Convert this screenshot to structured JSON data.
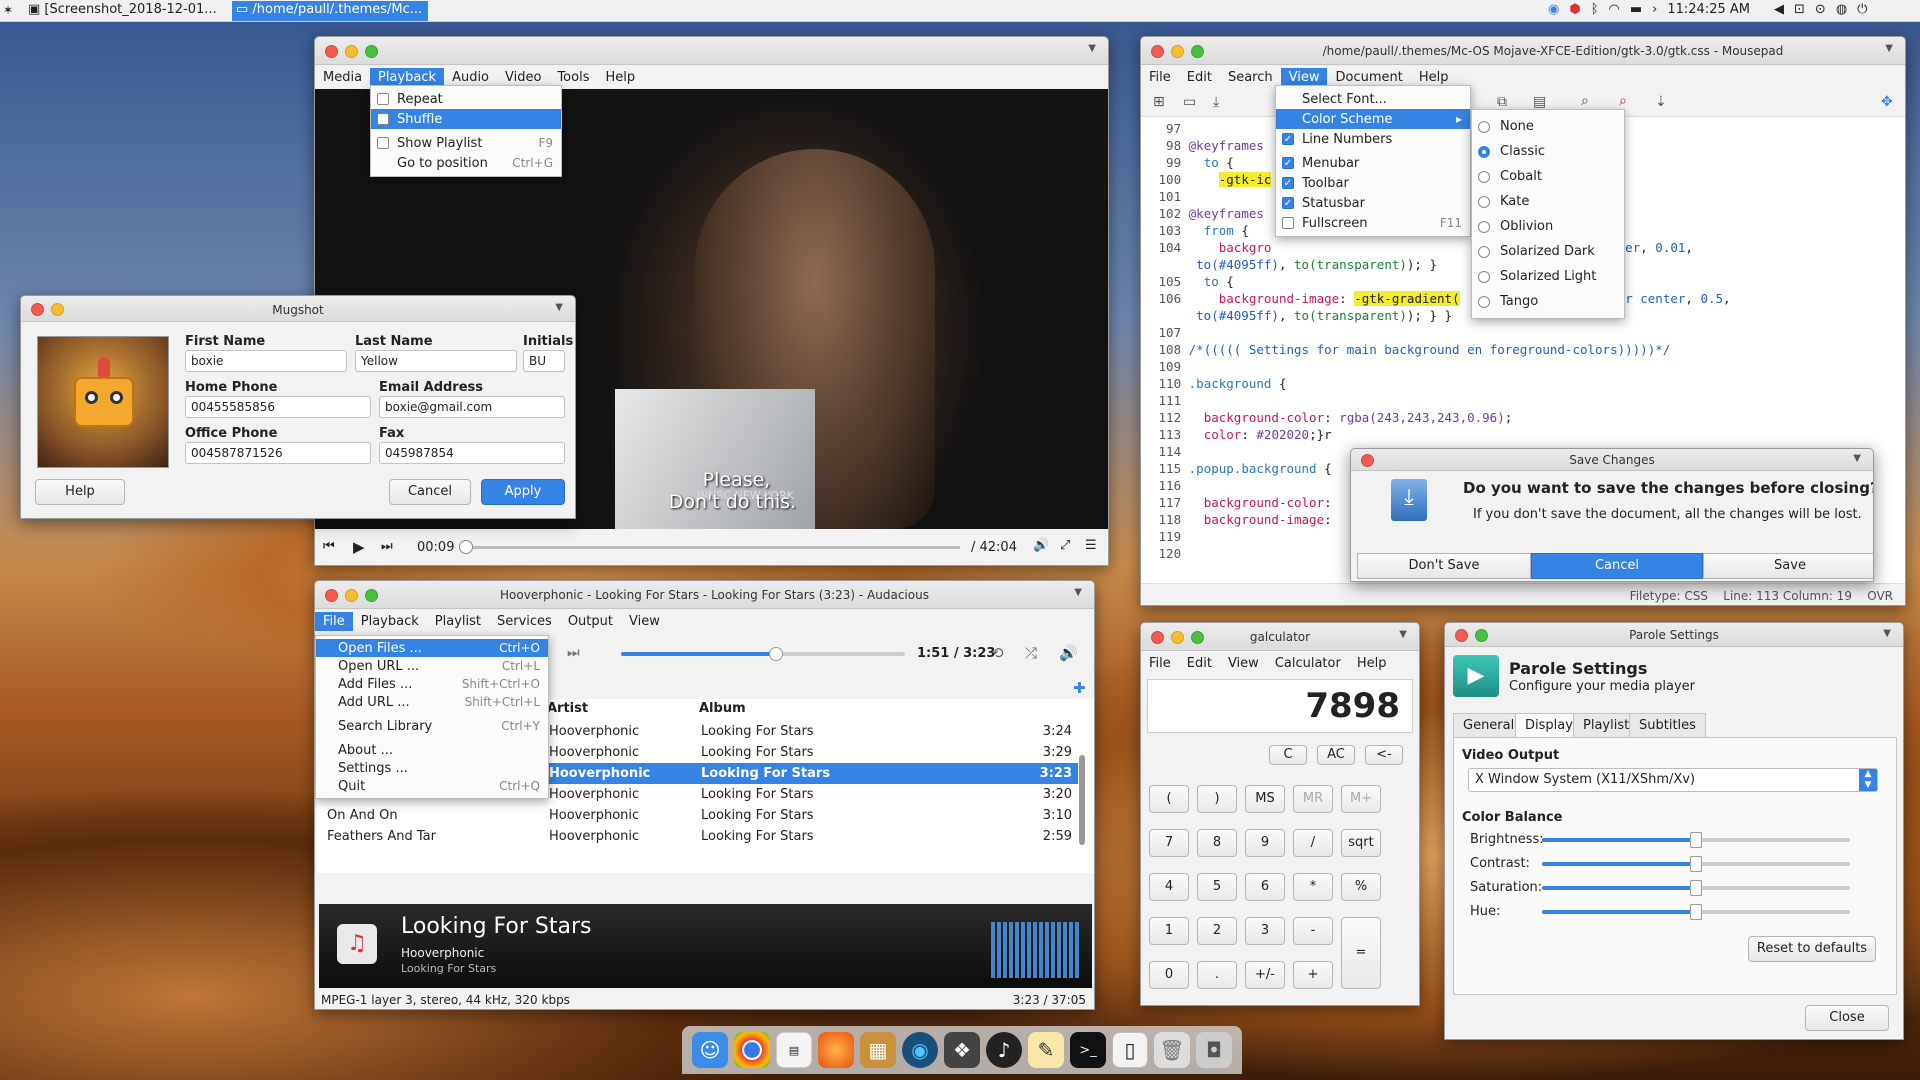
{
  "panel": {
    "task1": "[Screenshot_2018-12-01...",
    "task2": "/home/paull/.themes/Mc...",
    "time": "11:24:25 AM",
    "arrow": "›"
  },
  "vlc": {
    "menus": [
      "Media",
      "Playback",
      "Audio",
      "Video",
      "Tools",
      "Help"
    ],
    "menu_items": [
      {
        "label": "Repeat",
        "check": true,
        "accel": ""
      },
      {
        "label": "Shuffle",
        "check": true,
        "accel": ""
      },
      {
        "label": "Show Playlist",
        "check": true,
        "accel": "F9"
      },
      {
        "label": "Go to position",
        "check": false,
        "accel": "Ctrl+G"
      }
    ],
    "subtitle1": "Please,",
    "subtitle2": "Don't do this.",
    "watermark": "WNBC NEW YORK",
    "time_current": "00:09",
    "time_total": "/ 42:04",
    "progress": 0.0036
  },
  "mugshot": {
    "title": "Mugshot",
    "first_name_label": "First Name",
    "first_name": "boxie",
    "last_name_label": "Last Name",
    "last_name": "Yellow",
    "initials_label": "Initials",
    "initials": "BU",
    "home_phone_label": "Home Phone",
    "home_phone": "00455585856",
    "email_label": "Email Address",
    "email": "boxie@gmail.com",
    "office_phone_label": "Office Phone",
    "office_phone": "004587871526",
    "fax_label": "Fax",
    "fax": "045987854",
    "help": "Help",
    "cancel": "Cancel",
    "apply": "Apply"
  },
  "mousepad": {
    "title": "/home/paull/.themes/Mc-OS Mojave-XFCE-Edition/gtk-3.0/gtk.css - Mousepad",
    "menus": [
      "File",
      "Edit",
      "Search",
      "View",
      "Document",
      "Help"
    ],
    "view_menu": [
      {
        "label": "Select Font...",
        "type": "none",
        "accel": ""
      },
      {
        "label": "Color Scheme",
        "type": "sub",
        "accel": "▸"
      },
      {
        "label": "Line Numbers",
        "type": "check",
        "accel": ""
      },
      {
        "label": "Menubar",
        "type": "check",
        "accel": ""
      },
      {
        "label": "Toolbar",
        "type": "check",
        "accel": ""
      },
      {
        "label": "Statusbar",
        "type": "check",
        "accel": ""
      },
      {
        "label": "Fullscreen",
        "type": "uncheck",
        "accel": "F11"
      }
    ],
    "schemes": [
      {
        "label": "None",
        "on": false
      },
      {
        "label": "Classic",
        "on": true
      },
      {
        "label": "Cobalt",
        "on": false
      },
      {
        "label": "Kate",
        "on": false
      },
      {
        "label": "Oblivion",
        "on": false
      },
      {
        "label": "Solarized Dark",
        "on": false
      },
      {
        "label": "Solarized Light",
        "on": false
      },
      {
        "label": "Tango",
        "on": false
      }
    ],
    "status": "Filetype: CSS    Line: 113 Column: 19    OVR"
  },
  "save_dialog": {
    "title": "Save Changes",
    "heading": "Do you want to save the changes before closing?",
    "body": "If you don't save the document, all the changes will be lost.",
    "dont_save": "Don't Save",
    "cancel": "Cancel",
    "save": "Save"
  },
  "audacious": {
    "title": "Hoover­phonic - Looking For Stars - Looking For Stars (3:23) - Audacious",
    "menus": [
      "File",
      "Playback",
      "Playlist",
      "Services",
      "Output",
      "View"
    ],
    "file_menu": [
      {
        "label": "Open Files ...",
        "accel": "Ctrl+O",
        "hl": true
      },
      {
        "label": "Open URL ...",
        "accel": "Ctrl+L"
      },
      {
        "label": "Add Files ...",
        "accel": "Shift+Ctrl+O"
      },
      {
        "label": "Add URL ...",
        "accel": "Shift+Ctrl+L"
      },
      {
        "label": "Search Library",
        "accel": "Ctrl+Y"
      },
      {
        "label": "About ...",
        "accel": ""
      },
      {
        "label": "Settings ...",
        "accel": ""
      },
      {
        "label": "Quit",
        "accel": "Ctrl+Q"
      }
    ],
    "time": "1:51 / 3:23",
    "position": 0.547,
    "col_artist": "Artist",
    "col_album": "Album",
    "rows": [
      {
        "title": "",
        "artist": "Hooverphonic",
        "album": "Looking For Stars",
        "len": "3:24"
      },
      {
        "title": "",
        "artist": "Hooverphonic",
        "album": "Looking For Stars",
        "len": "3:29"
      },
      {
        "title": "",
        "artist": "Hooverphonic",
        "album": "Looking For Stars",
        "len": "3:23"
      },
      {
        "title": "",
        "artist": "Hooverphonic",
        "album": "Looking For Stars",
        "len": "3:20"
      },
      {
        "title": "On And On",
        "artist": "Hooverphonic",
        "album": "Looking For Stars",
        "len": "3:10"
      },
      {
        "title": "Feathers And Tar",
        "artist": "Hooverphonic",
        "album": "Looking For Stars",
        "len": "2:59"
      }
    ],
    "np_title": "Looking For Stars",
    "np_artist": "Hooverphonic",
    "np_album": "Looking For Stars",
    "status_left": "MPEG-1 layer 3, stereo, 44 kHz, 320 kbps",
    "status_right": "3:23 / 37:05"
  },
  "galculator": {
    "title": "galculator",
    "menus": [
      "File",
      "Edit",
      "View",
      "Calculator",
      "Help"
    ],
    "display": "7898",
    "keys": [
      [
        "C",
        "AC",
        "<-"
      ],
      [
        "(",
        ")",
        "MS",
        "MR",
        "M+"
      ],
      [
        "7",
        "8",
        "9",
        "/",
        "sqrt"
      ],
      [
        "4",
        "5",
        "6",
        "*",
        "%"
      ],
      [
        "1",
        "2",
        "3",
        "-",
        "="
      ],
      [
        "0",
        ".",
        "+/-",
        "+"
      ]
    ]
  },
  "parole": {
    "title": "Parole Settings",
    "heading": "Parole Settings",
    "sub": "Configure your media player",
    "tabs": [
      "General",
      "Display",
      "Playlist",
      "Subtitles"
    ],
    "video_output_label": "Video Output",
    "video_output": "X Window System (X11/XShm/Xv)",
    "color_balance": "Color Balance",
    "brightness": "Brightness:",
    "contrast": "Contrast:",
    "saturation": "Saturation:",
    "hue": "Hue:",
    "levels": [
      0.5,
      0.5,
      0.5,
      0.5
    ],
    "reset": "Reset to defaults",
    "close": "Close"
  }
}
